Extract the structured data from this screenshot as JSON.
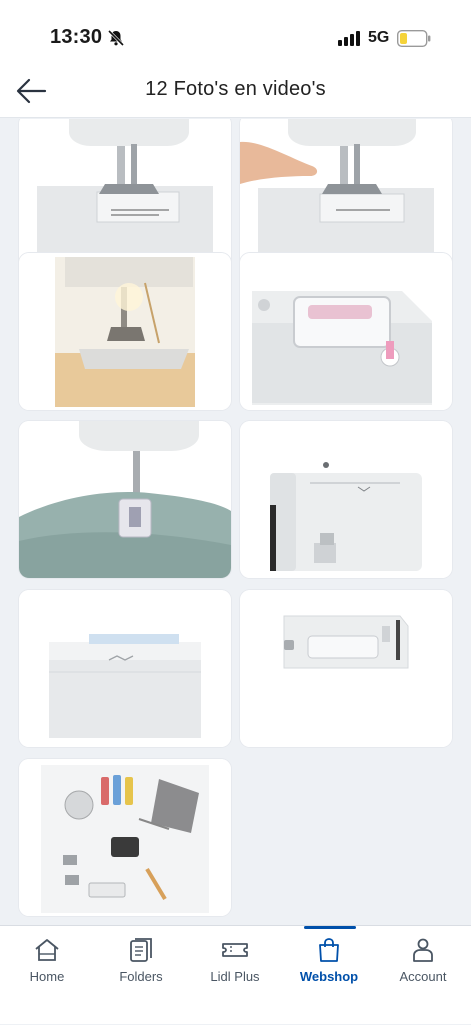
{
  "status": {
    "time": "13:30",
    "network": "5G"
  },
  "header": {
    "title": "12 Foto's en video's"
  },
  "gallery": {
    "items": [
      {
        "name": "photo-presser-foot-closeup"
      },
      {
        "name": "photo-finger-at-presser-foot"
      },
      {
        "name": "photo-lit-needle-plate"
      },
      {
        "name": "photo-top-view-handle-thread"
      },
      {
        "name": "photo-sewing-fabric"
      },
      {
        "name": "photo-side-panel"
      },
      {
        "name": "photo-top-cover"
      },
      {
        "name": "photo-machine-back"
      },
      {
        "name": "photo-accessories-set"
      }
    ]
  },
  "tabbar": {
    "items": [
      {
        "label": "Home",
        "icon": "home-icon"
      },
      {
        "label": "Folders",
        "icon": "folders-icon"
      },
      {
        "label": "Lidl Plus",
        "icon": "ticket-icon"
      },
      {
        "label": "Webshop",
        "icon": "shopping-bag-icon",
        "active": true
      },
      {
        "label": "Account",
        "icon": "account-icon"
      }
    ]
  },
  "colors": {
    "accent": "#0050aa",
    "background": "#eef1f5",
    "battery": "#f5d33a"
  }
}
